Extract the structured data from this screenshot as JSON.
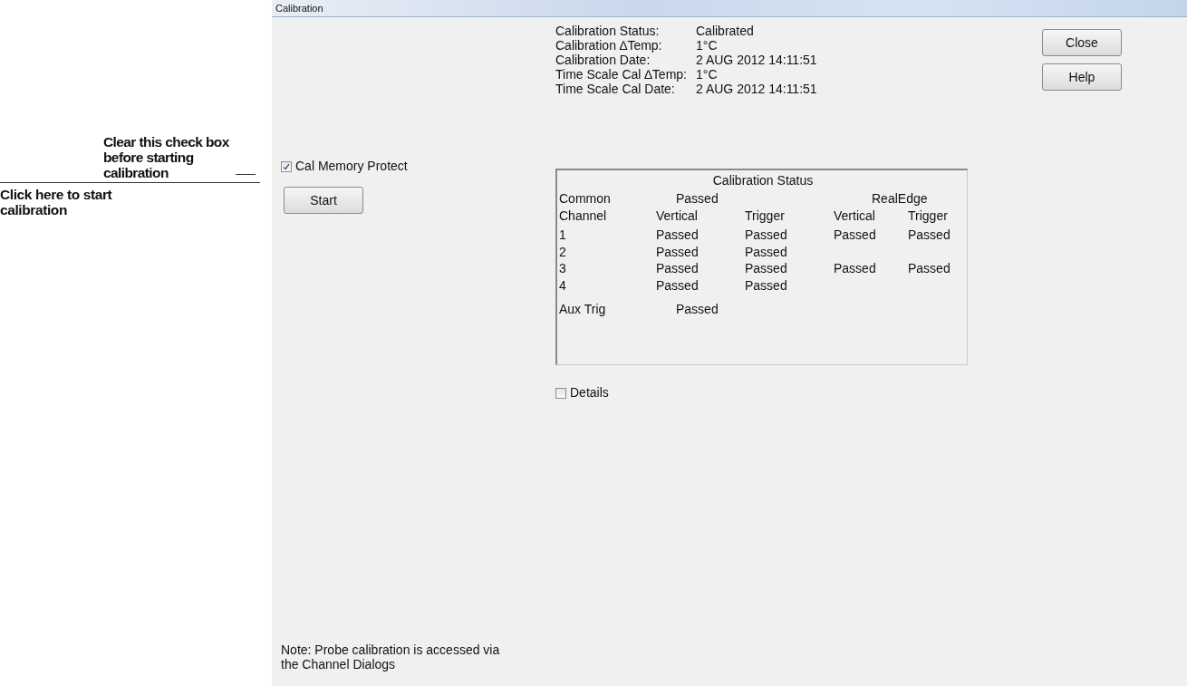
{
  "window": {
    "title": "Calibration"
  },
  "annotations": [
    {
      "kind": "side",
      "text": "Clear this check box before starting calibration"
    },
    {
      "kind": "above",
      "text": "Click here to start calibration"
    }
  ],
  "cal_memory_protect": {
    "label": "Cal Memory Protect",
    "checked": true
  },
  "start_button": "Start",
  "info": [
    {
      "label": "Calibration Status:",
      "value": "Calibrated"
    },
    {
      "label": "Calibration ∆Temp:",
      "value": "1°C"
    },
    {
      "label": "Calibration Date:",
      "value": "2 AUG 2012 14:11:51"
    },
    {
      "label": "Time Scale Cal ∆Temp:",
      "value": "1°C"
    },
    {
      "label": "Time Scale Cal Date:",
      "value": "2 AUG 2012 14:11:51"
    }
  ],
  "buttons": [
    "Close",
    "Help"
  ],
  "status_panel": {
    "title": "Calibration Status",
    "common_label": "Common",
    "common_value": "Passed",
    "realedge_label": "RealEdge",
    "headers": [
      "Channel",
      "Vertical",
      "Trigger",
      "Vertical",
      "Trigger"
    ],
    "rows": [
      {
        "cells": [
          "1",
          "Passed",
          "Passed",
          "Passed",
          "Passed"
        ]
      },
      {
        "cells": [
          "2",
          "Passed",
          "Passed"
        ]
      },
      {
        "cells": [
          "3",
          "Passed",
          "Passed",
          "Passed",
          "Passed"
        ]
      },
      {
        "cells": [
          "4",
          "Passed",
          "Passed"
        ]
      }
    ],
    "aux_label": "Aux Trig",
    "aux_value": "Passed"
  },
  "details": {
    "label": "Details",
    "checked": false
  },
  "note": "Note: Probe calibration is accessed via the Channel Dialogs"
}
